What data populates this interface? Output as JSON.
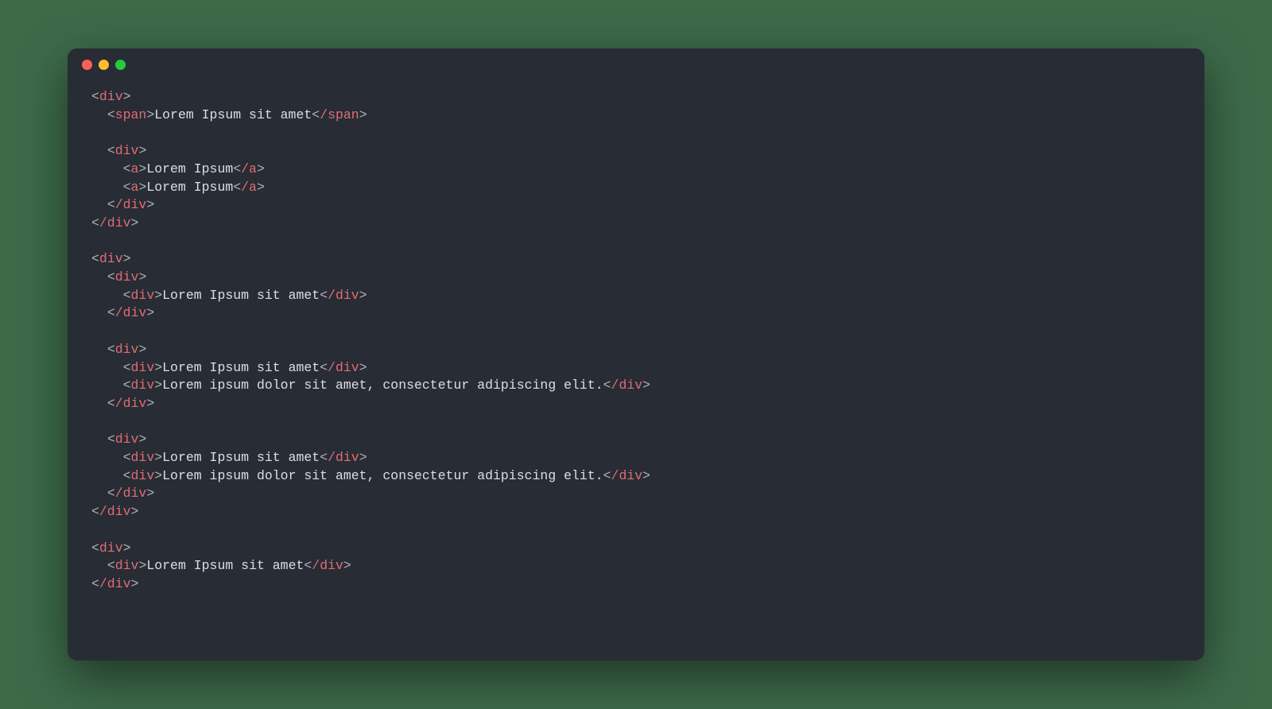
{
  "code": {
    "tags": {
      "div_open": "div",
      "div_close": "/div",
      "span_open": "span",
      "span_close": "/span",
      "a_open": "a",
      "a_close": "/a"
    },
    "texts": {
      "lorem_ipsum_sit_amet": "Lorem Ipsum sit amet",
      "lorem_ipsum": "Lorem Ipsum",
      "lorem_long": "Lorem ipsum dolor sit amet, consectetur adipiscing elit."
    },
    "brackets": {
      "lt": "<",
      "gt": ">"
    }
  },
  "colors": {
    "background": "#282c34",
    "tag": "#e06c75",
    "text": "#dcdfe4",
    "bracket": "#abb2bf",
    "page_bg": "#3d6b4a"
  }
}
